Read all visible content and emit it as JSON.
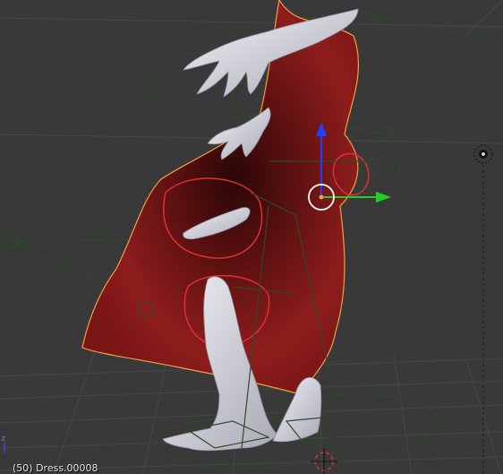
{
  "viewport": {
    "name": "3D View",
    "mode": "Object Mode",
    "info_text": "(50) Dress.00008",
    "axis_indicator": "z"
  },
  "colors": {
    "background": "#393939",
    "grid": "#4a4a4a",
    "dress": "#8a1a1a",
    "dress_shadow": "#1a0505",
    "selection_outline": "#f0a040",
    "armature": "#2e4a2a",
    "skin": "#d8d8e0",
    "gizmo_z": "#2040ff",
    "gizmo_y": "#20d020",
    "gizmo_x": "#e02020",
    "weight_circles": "#e03030"
  },
  "objects": [
    {
      "name": "Dress",
      "selected": true
    },
    {
      "name": "Body",
      "selected": false
    },
    {
      "name": "Armature",
      "selected": false
    },
    {
      "name": "Lamp",
      "selected": false
    },
    {
      "name": "3D Cursor",
      "selected": false
    }
  ]
}
